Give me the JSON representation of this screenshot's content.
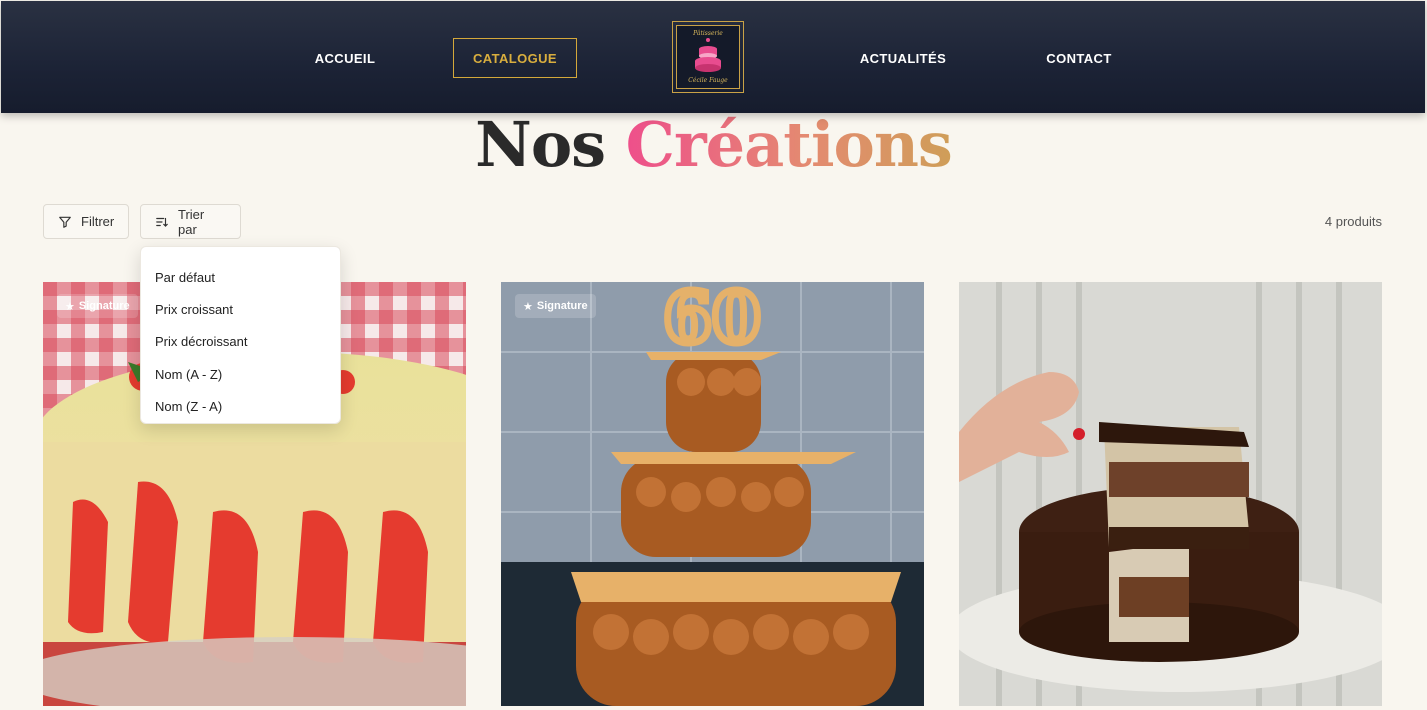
{
  "header": {
    "nav": [
      {
        "label": "ACCUEIL"
      },
      {
        "label": "CATALOGUE",
        "active": true
      },
      {
        "label": "ACTUALITÉS"
      },
      {
        "label": "CONTACT"
      }
    ],
    "logo": {
      "top_text": "Pâtisserie",
      "bottom_text": "Cécile Fauge"
    },
    "accent_color": "#d4a83a"
  },
  "page": {
    "title_part1": "Nos",
    "title_part2": "Créations"
  },
  "toolbar": {
    "filter_label": "Filtrer",
    "sort_label": "Trier par",
    "count_label": "4 produits"
  },
  "sort_menu": {
    "options": [
      "Par défaut",
      "Prix croissant",
      "Prix décroissant",
      "Nom (A - Z)",
      "Nom (Z - A)"
    ]
  },
  "products": [
    {
      "badge": "Signature",
      "image": "fraisier-cake"
    },
    {
      "badge": "Signature",
      "image": "croquembouche-60"
    },
    {
      "badge": "",
      "image": "chocolate-entremet"
    }
  ]
}
